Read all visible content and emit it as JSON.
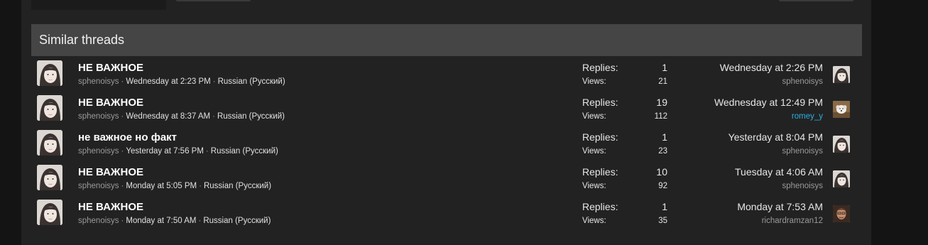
{
  "section": {
    "title": "Similar threads"
  },
  "colors": {
    "accent_user": "#2bb0e0",
    "header_bg": "#454545"
  },
  "threads": [
    {
      "title": "НЕ ВАЖНОЕ",
      "author": "sphenoisys",
      "date": "Wednesday at 2:23 PM",
      "forum": "Russian (Русский)",
      "replies_label": "Replies:",
      "replies": "1",
      "views_label": "Views:",
      "views": "21",
      "last_date": "Wednesday at 2:26 PM",
      "last_user": "sphenoisys",
      "last_avatar": "girl-avatar"
    },
    {
      "title": "НЕ ВАЖНОЕ",
      "author": "sphenoisys",
      "date": "Wednesday at 8:37 AM",
      "forum": "Russian (Русский)",
      "replies_label": "Replies:",
      "replies": "19",
      "views_label": "Views:",
      "views": "112",
      "last_date": "Wednesday at 12:49 PM",
      "last_user": "romey_y",
      "last_avatar": "dog-avatar"
    },
    {
      "title": "не важное но факт",
      "author": "sphenoisys",
      "date": "Yesterday at 7:56 PM",
      "forum": "Russian (Русский)",
      "replies_label": "Replies:",
      "replies": "1",
      "views_label": "Views:",
      "views": "23",
      "last_date": "Yesterday at 8:04 PM",
      "last_user": "sphenoisys",
      "last_avatar": "girl-avatar"
    },
    {
      "title": "НЕ ВАЖНОЕ",
      "author": "sphenoisys",
      "date": "Monday at 5:05 PM",
      "forum": "Russian (Русский)",
      "replies_label": "Replies:",
      "replies": "10",
      "views_label": "Views:",
      "views": "92",
      "last_date": "Tuesday at 4:06 AM",
      "last_user": "sphenoisys",
      "last_avatar": "girl-avatar"
    },
    {
      "title": "НЕ ВАЖНОЕ",
      "author": "sphenoisys",
      "date": "Monday at 7:50 AM",
      "forum": "Russian (Русский)",
      "replies_label": "Replies:",
      "replies": "1",
      "views_label": "Views:",
      "views": "35",
      "last_date": "Monday at 7:53 AM",
      "last_user": "richardramzan12",
      "last_avatar": "man-avatar"
    }
  ]
}
